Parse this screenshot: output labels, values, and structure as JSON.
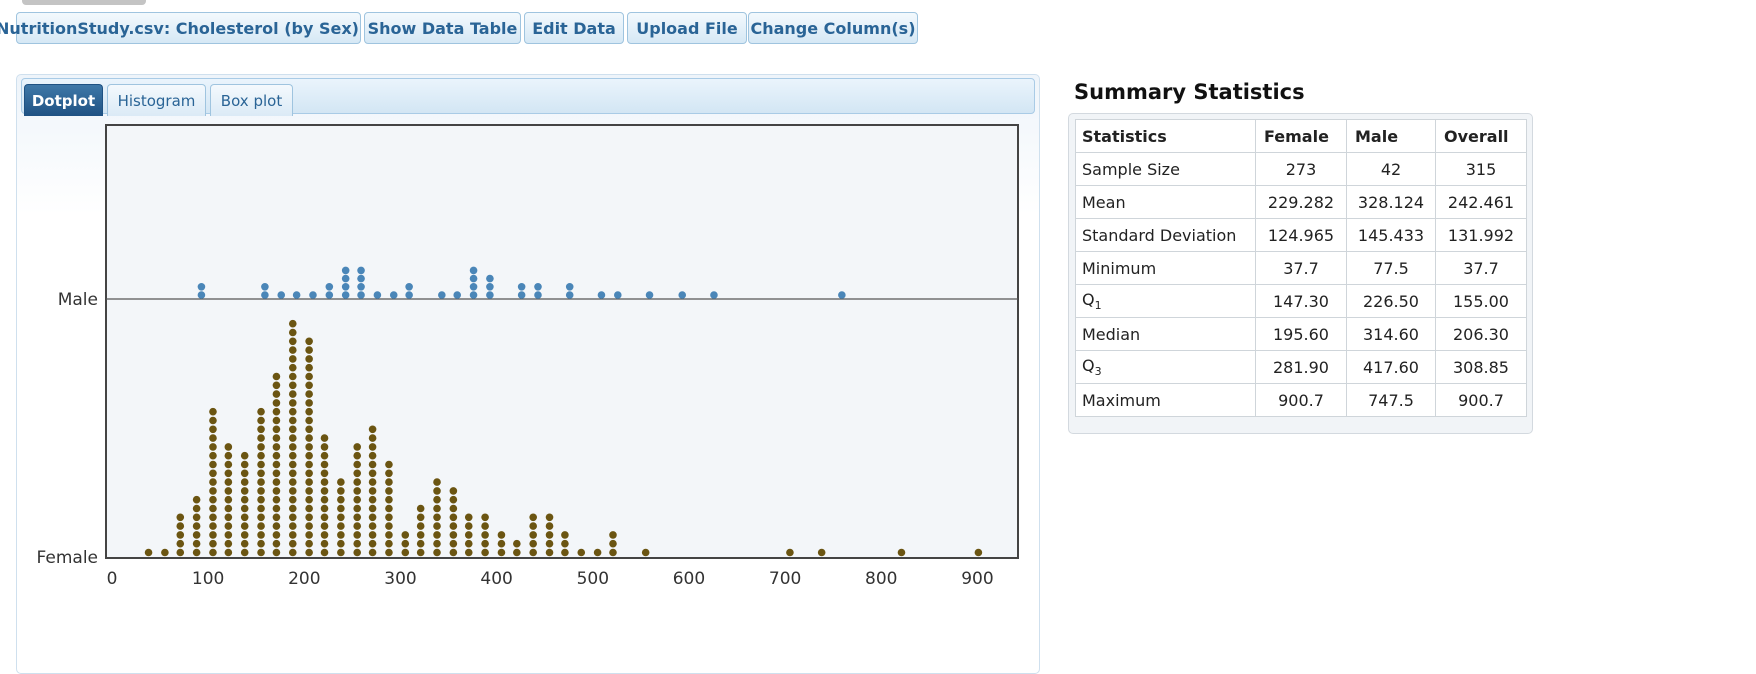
{
  "toolbar": {
    "dataset_label": "NutritionStudy.csv: Cholesterol (by Sex)",
    "show_table": "Show Data Table",
    "edit_data": "Edit Data",
    "upload_file": "Upload File",
    "change_columns": "Change Column(s)"
  },
  "tabs": [
    "Dotplot",
    "Histogram",
    "Box plot"
  ],
  "active_tab": "Dotplot",
  "colors": {
    "male": "#4a86b8",
    "female": "#6b5512",
    "accent": "#2a6496"
  },
  "chart_data": {
    "type": "scatter",
    "subtype": "stacked dotplot",
    "title": "",
    "xlabel": "",
    "ylabel": "",
    "xlim": [
      0,
      950
    ],
    "x_ticks": [
      0,
      100,
      200,
      300,
      400,
      500,
      600,
      700,
      800,
      900
    ],
    "groups": [
      "Male",
      "Female"
    ],
    "bin_width": 16.7,
    "series": [
      {
        "name": "Male",
        "bins": [
          {
            "x": 93,
            "count": 2
          },
          {
            "x": 159,
            "count": 2
          },
          {
            "x": 176,
            "count": 1
          },
          {
            "x": 192,
            "count": 1
          },
          {
            "x": 209,
            "count": 1
          },
          {
            "x": 226,
            "count": 2
          },
          {
            "x": 243,
            "count": 4
          },
          {
            "x": 259,
            "count": 4
          },
          {
            "x": 276,
            "count": 1
          },
          {
            "x": 293,
            "count": 1
          },
          {
            "x": 309,
            "count": 2
          },
          {
            "x": 343,
            "count": 1
          },
          {
            "x": 359,
            "count": 1
          },
          {
            "x": 376,
            "count": 4
          },
          {
            "x": 393,
            "count": 3
          },
          {
            "x": 426,
            "count": 2
          },
          {
            "x": 443,
            "count": 2
          },
          {
            "x": 476,
            "count": 2
          },
          {
            "x": 509,
            "count": 1
          },
          {
            "x": 526,
            "count": 1
          },
          {
            "x": 559,
            "count": 1
          },
          {
            "x": 593,
            "count": 1
          },
          {
            "x": 626,
            "count": 1
          },
          {
            "x": 759,
            "count": 1
          }
        ]
      },
      {
        "name": "Female",
        "bins": [
          {
            "x": 38,
            "count": 1
          },
          {
            "x": 55,
            "count": 1
          },
          {
            "x": 71,
            "count": 5
          },
          {
            "x": 88,
            "count": 7
          },
          {
            "x": 105,
            "count": 17
          },
          {
            "x": 121,
            "count": 13
          },
          {
            "x": 138,
            "count": 12
          },
          {
            "x": 155,
            "count": 17
          },
          {
            "x": 171,
            "count": 21
          },
          {
            "x": 188,
            "count": 28
          },
          {
            "x": 205,
            "count": 25
          },
          {
            "x": 221,
            "count": 14
          },
          {
            "x": 238,
            "count": 9
          },
          {
            "x": 255,
            "count": 13
          },
          {
            "x": 271,
            "count": 15
          },
          {
            "x": 288,
            "count": 11
          },
          {
            "x": 305,
            "count": 3
          },
          {
            "x": 321,
            "count": 6
          },
          {
            "x": 338,
            "count": 9
          },
          {
            "x": 355,
            "count": 8
          },
          {
            "x": 371,
            "count": 5
          },
          {
            "x": 388,
            "count": 5
          },
          {
            "x": 405,
            "count": 3
          },
          {
            "x": 421,
            "count": 2
          },
          {
            "x": 438,
            "count": 5
          },
          {
            "x": 455,
            "count": 5
          },
          {
            "x": 471,
            "count": 3
          },
          {
            "x": 488,
            "count": 1
          },
          {
            "x": 505,
            "count": 1
          },
          {
            "x": 521,
            "count": 3
          },
          {
            "x": 555,
            "count": 1
          },
          {
            "x": 705,
            "count": 1
          },
          {
            "x": 738,
            "count": 1
          },
          {
            "x": 821,
            "count": 1
          },
          {
            "x": 901,
            "count": 1
          }
        ]
      }
    ]
  },
  "summary": {
    "title": "Summary Statistics",
    "headers": [
      "Statistics",
      "Female",
      "Male",
      "Overall"
    ],
    "rows": [
      {
        "label": "Sample Size",
        "female": "273",
        "male": "42",
        "overall": "315"
      },
      {
        "label": "Mean",
        "female": "229.282",
        "male": "328.124",
        "overall": "242.461"
      },
      {
        "label": "Standard Deviation",
        "female": "124.965",
        "male": "145.433",
        "overall": "131.992"
      },
      {
        "label": "Minimum",
        "female": "37.7",
        "male": "77.5",
        "overall": "37.7"
      },
      {
        "label": "Q",
        "label_sub": "1",
        "female": "147.30",
        "male": "226.50",
        "overall": "155.00"
      },
      {
        "label": "Median",
        "female": "195.60",
        "male": "314.60",
        "overall": "206.30"
      },
      {
        "label": "Q",
        "label_sub": "3",
        "female": "281.90",
        "male": "417.60",
        "overall": "308.85"
      },
      {
        "label": "Maximum",
        "female": "900.7",
        "male": "747.5",
        "overall": "900.7"
      }
    ]
  }
}
